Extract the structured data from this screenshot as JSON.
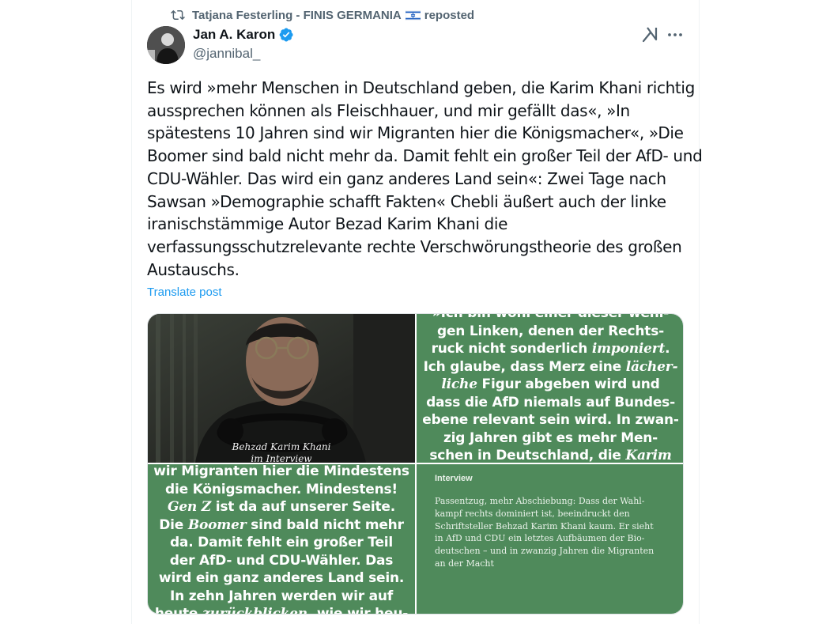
{
  "repost": {
    "reposter": "Tatjana Festerling - FINIS GERMANIA",
    "label": "reposted",
    "repost_icon": "repost-icon",
    "flag_icon": "israel-flag-icon"
  },
  "author": {
    "display_name": "Jan A. Karon",
    "handle": "@jannibal_",
    "verified": true,
    "verified_color": "#1d9bf0"
  },
  "actions": {
    "grok_icon": "grok-icon",
    "more_icon": "more-dots-icon"
  },
  "tweet": {
    "lines": [
      "Es wird »mehr Menschen in Deutschland geben, die Karim Khani richtig",
      "aussprechen können als Fleischhauer, und mir gefällt das«, »In",
      "spätestens 10 Jahren sind wir Migranten hier die Königsmacher«, »Die",
      "Boomer sind bald nicht mehr da. Damit fehlt ein großer Teil der AfD- und",
      "CDU-Wähler. Das wird ein ganz anderes Land sein«: Zwei Tage nach",
      "Sawsan »Demographie schafft Fakten« Chebli äußert auch der linke",
      "iranischstämmige Autor Bezad Karim Khani die",
      "verfassungsschutzrelevante rechte Verschwörungstheorie des großen",
      "Austauschs."
    ],
    "translate_label": "Translate post"
  },
  "media": {
    "accent_green": "#4f8a5b",
    "photo_caption_1": "Behzad Karim Khani",
    "photo_caption_2": "im Interview",
    "top_right": {
      "l0": "»Ich bin wohl einer dieser weni-",
      "l1": "gen Linken, denen der Rechts-",
      "l2a": "ruck nicht sonderlich ",
      "l2b": "imponiert",
      "l2c": ".",
      "l3a": "Ich glaube, dass Merz eine ",
      "l3b": "lächer-",
      "l4a": "liche",
      "l4b": " Figur abgeben wird und",
      "l5": "dass die AfD niemals auf Bundes-",
      "l6": "ebene relevant sein wird. In zwan-",
      "l7": "zig Jahren gibt es mehr Men-",
      "l8a": "schen in Deutschland, die ",
      "l8b": "Karim"
    },
    "bottom_left": {
      "l0": "wir Migranten hier die Mindestens",
      "l1": "die Königsmacher. Mindestens!",
      "l2a": "Gen Z",
      "l2b": " ist da auf unserer Seite.",
      "l3a": "Die ",
      "l3b": "Boomer",
      "l3c": " sind bald nicht mehr",
      "l4": "da. Damit fehlt ein großer Teil",
      "l5": "der AfD- und CDU-Wähler. Das",
      "l6": "wird ein ganz anderes Land sein.",
      "l7": "In zehn Jahren werden wir auf",
      "l8a": "heute ",
      "l8b": "zurückblicken",
      "l8c": ", wie wir heu-"
    },
    "bottom_right": {
      "label": "Interview",
      "lines": [
        "Passentzug, mehr Abschiebung: Dass der Wahl-",
        "kampf rechts dominiert ist, beeindruckt den",
        "Schriftsteller Behzad Karim Khani kaum. Er sieht",
        "in AfD und CDU ein letztes Aufbäumen der Bio-",
        "deutschen – und in zwanzig Jahren die Migranten",
        "an der Macht"
      ]
    }
  }
}
